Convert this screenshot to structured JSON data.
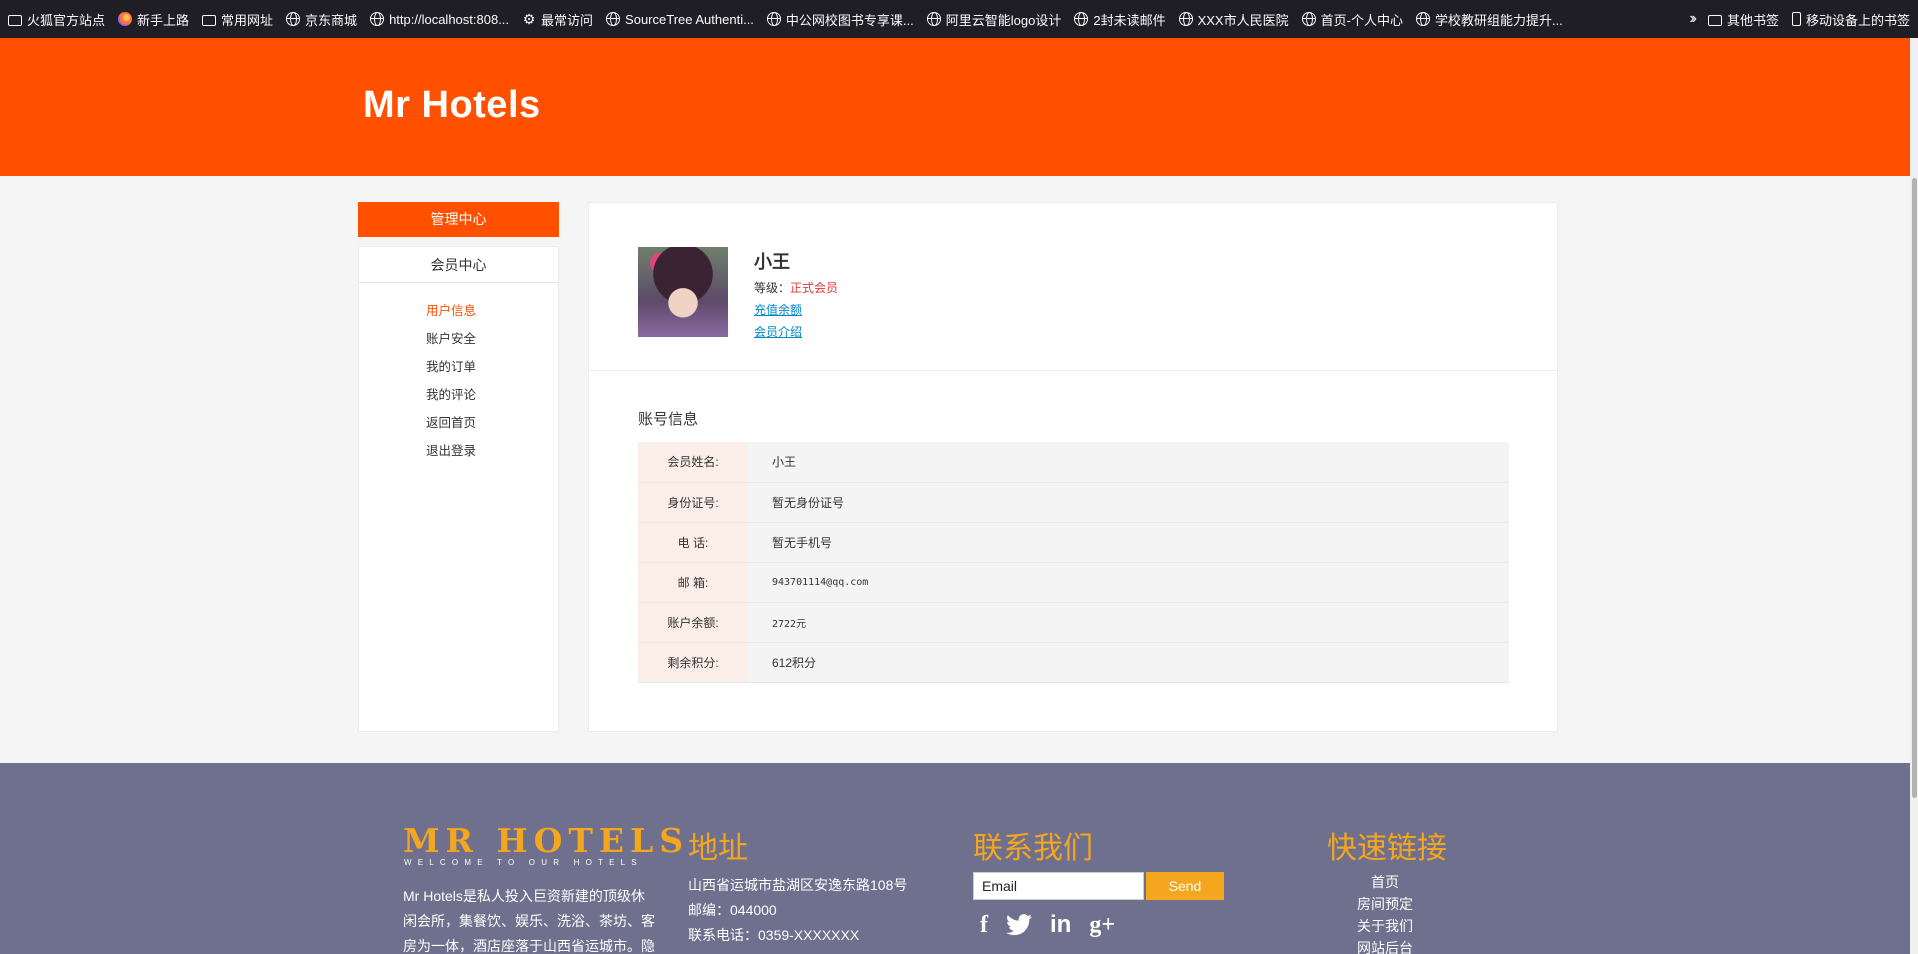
{
  "bookmarks": {
    "items": [
      {
        "label": "火狐官方站点",
        "icon": "folder-icon"
      },
      {
        "label": "新手上路",
        "icon": "firefox-icon"
      },
      {
        "label": "常用网址",
        "icon": "folder-icon"
      },
      {
        "label": "京东商城",
        "icon": "globe-icon"
      },
      {
        "label": "http://localhost:808...",
        "icon": "globe-icon"
      },
      {
        "label": "最常访问",
        "icon": "gear-icon"
      },
      {
        "label": "SourceTree Authenti...",
        "icon": "globe-icon"
      },
      {
        "label": "中公网校图书专享课...",
        "icon": "globe-icon"
      },
      {
        "label": "阿里云智能logo设计",
        "icon": "globe-icon"
      },
      {
        "label": "2封未读邮件",
        "icon": "globe-icon"
      },
      {
        "label": "XXX市人民医院",
        "icon": "globe-icon"
      },
      {
        "label": "首页-个人中心",
        "icon": "globe-icon"
      },
      {
        "label": "学校教研组能力提升...",
        "icon": "globe-icon"
      }
    ],
    "other": "其他书签",
    "mobile": "移动设备上的书签"
  },
  "header": {
    "title": "Mr Hotels"
  },
  "sidebar": {
    "header": "管理中心",
    "section": "会员中心",
    "items": [
      "用户信息",
      "账户安全",
      "我的订单",
      "我的评论",
      "返回首页",
      "退出登录"
    ]
  },
  "profile": {
    "name": "小王",
    "level_label": "等级：",
    "level_value": "正式会员",
    "recharge_link": "充值余额",
    "intro_link": "会员介绍"
  },
  "account": {
    "title": "账号信息",
    "rows": [
      {
        "label": "会员姓名:",
        "value": "小王"
      },
      {
        "label": "身份证号:",
        "value": "暂无身份证号"
      },
      {
        "label": "电 话:",
        "value": "暂无手机号"
      },
      {
        "label": "邮 箱:",
        "value": "943701114@qq.com"
      },
      {
        "label": "账户余额:",
        "value": "2722元"
      },
      {
        "label": "剩余积分:",
        "value": "612积分"
      }
    ]
  },
  "footer": {
    "logo": "MR HOTELS",
    "tagline": "WELCOME TO OUR HOTELS",
    "description": "Mr Hotels是私人投入巨资新建的顶级休闲会所，集餐饮、娱乐、洗浴、茶坊、客房为一体，酒店座落于山西省运城市。隐",
    "address_title": "地址",
    "address_lines": [
      "山西省运城市盐湖区安逸东路108号",
      "邮编：044000",
      "联系电话：0359-XXXXXXX"
    ],
    "contact_title": "联系我们",
    "email_placeholder": "Email",
    "send_label": "Send",
    "social": [
      "facebook-icon",
      "twitter-icon",
      "linkedin-icon",
      "google-plus-icon"
    ],
    "links_title": "快速链接",
    "links": [
      "首页",
      "房间预定",
      "关于我们",
      "网站后台"
    ]
  },
  "colors": {
    "brand": "#ff5000",
    "footer_bg": "#6e708d",
    "accent": "#f3a61e",
    "link": "#0088cc",
    "level": "#e4393c"
  }
}
